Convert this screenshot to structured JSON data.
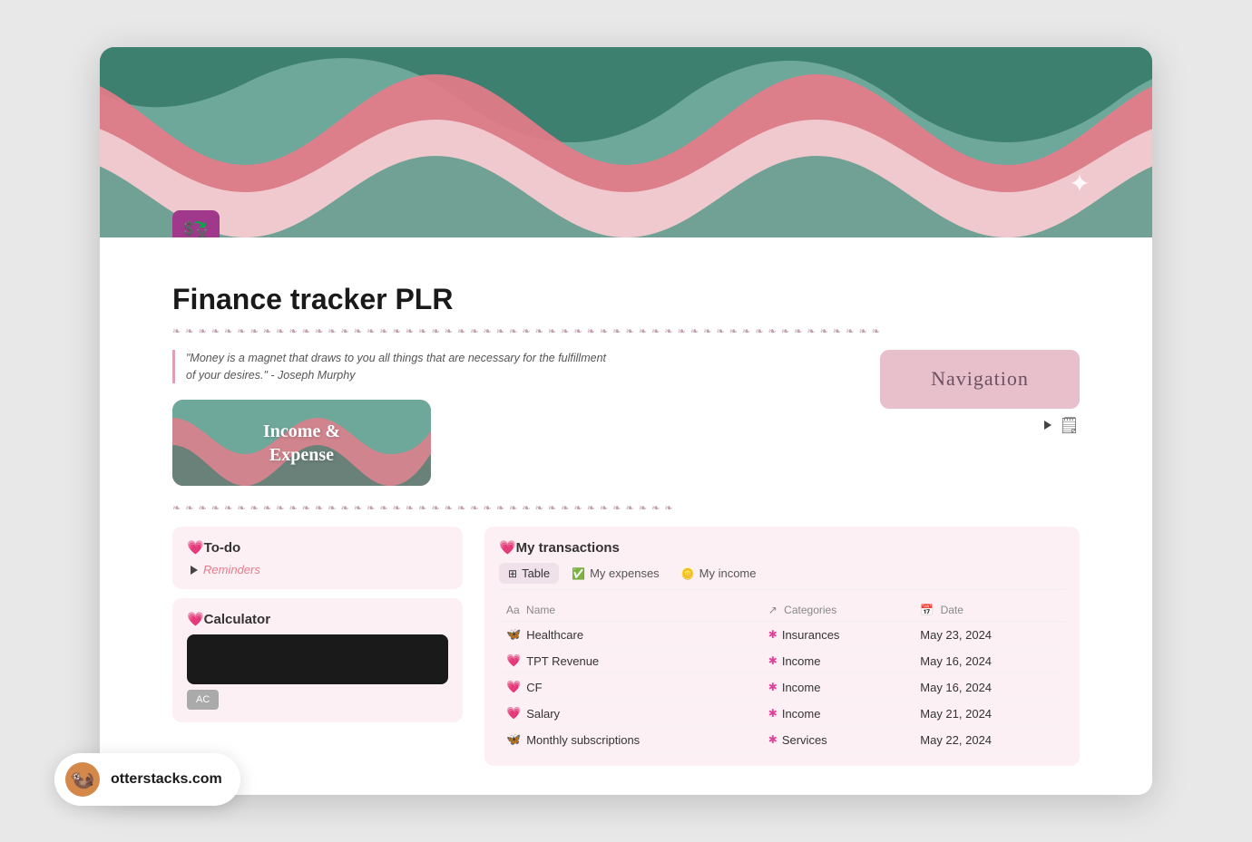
{
  "page": {
    "title": "Finance tracker PLR",
    "icon": "💱",
    "banner_alt": "Wavy retro pattern banner"
  },
  "quote": {
    "text": "\"Money is a magnet that draws to you all things that are necessary for the fulfillment of your desires.\" - Joseph Murphy"
  },
  "income_expense_card": {
    "label": "Income &\nExpense"
  },
  "navigation": {
    "label": "Navigation"
  },
  "divider_text": "❧ ❧ ❧ ❧ ❧ ❧ ❧ ❧ ❧ ❧ ❧ ❧ ❧ ❧ ❧ ❧ ❧ ❧ ❧ ❧ ❧ ❧ ❧ ❧ ❧ ❧ ❧ ❧ ❧ ❧ ❧ ❧ ❧ ❧ ❧ ❧ ❧ ❧ ❧ ❧ ❧ ❧ ❧ ❧ ❧ ❧ ❧ ❧ ❧ ❧ ❧ ❧ ❧ ❧ ❧",
  "divider_text2": "❧ ❧ ❧ ❧ ❧ ❧ ❧ ❧ ❧ ❧ ❧ ❧ ❧ ❧ ❧ ❧ ❧ ❧ ❧ ❧ ❧ ❧ ❧ ❧ ❧ ❧ ❧ ❧ ❧ ❧ ❧ ❧ ❧ ❧ ❧ ❧ ❧ ❧ ❧",
  "todo": {
    "heading": "💗To-do",
    "reminders_label": "Reminders"
  },
  "calculator": {
    "heading": "💗Calculator",
    "ac_label": "AC"
  },
  "transactions": {
    "heading": "💗My transactions",
    "tabs": [
      {
        "id": "table",
        "label": "Table",
        "icon": "⊞",
        "active": true
      },
      {
        "id": "expenses",
        "label": "My expenses",
        "icon": "✅",
        "active": false
      },
      {
        "id": "income",
        "label": "My income",
        "icon": "🪙",
        "active": false
      }
    ],
    "columns": [
      {
        "id": "name",
        "label": "Name",
        "icon": "Aa"
      },
      {
        "id": "categories",
        "label": "Categories",
        "icon": "↗"
      },
      {
        "id": "date",
        "label": "Date",
        "icon": "📅"
      }
    ],
    "rows": [
      {
        "name": "Healthcare",
        "emoji": "🦋",
        "category": "Insurances",
        "date": "May 23, 2024"
      },
      {
        "name": "TPT Revenue",
        "emoji": "💗",
        "category": "Income",
        "date": "May 16, 2024"
      },
      {
        "name": "CF",
        "emoji": "💗",
        "category": "Income",
        "date": "May 16, 2024"
      },
      {
        "name": "Salary",
        "emoji": "💗",
        "category": "Income",
        "date": "May 21, 2024"
      },
      {
        "name": "Monthly subscriptions",
        "emoji": "🦋",
        "category": "Services",
        "date": "May 22, 2024"
      }
    ]
  },
  "otter": {
    "domain": "otterstacks.com",
    "emoji": "🦦"
  }
}
